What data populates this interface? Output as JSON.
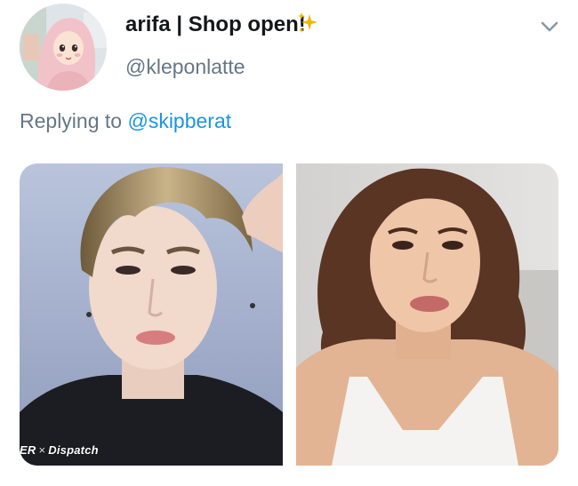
{
  "tweet": {
    "author": {
      "display_name": "arifa | Shop open!",
      "handle": "@kleponlatte",
      "avatar_icon": "hijab-girl-cartoon-avatar",
      "badge_icon": "sparkles-icon"
    },
    "reply": {
      "prefix": "Replying to",
      "mention": "@skipberat"
    },
    "menu_icon": "chevron-down-icon",
    "media": [
      {
        "name": "photo-young-man",
        "watermark_left": "ER",
        "watermark_separator": "×",
        "watermark_right": "Dispatch"
      },
      {
        "name": "photo-young-woman"
      }
    ]
  },
  "colors": {
    "text_primary": "#14171a",
    "text_secondary": "#657786",
    "link": "#1b95e0",
    "caret": "#8899a6",
    "sparkle": "#f5b400"
  }
}
